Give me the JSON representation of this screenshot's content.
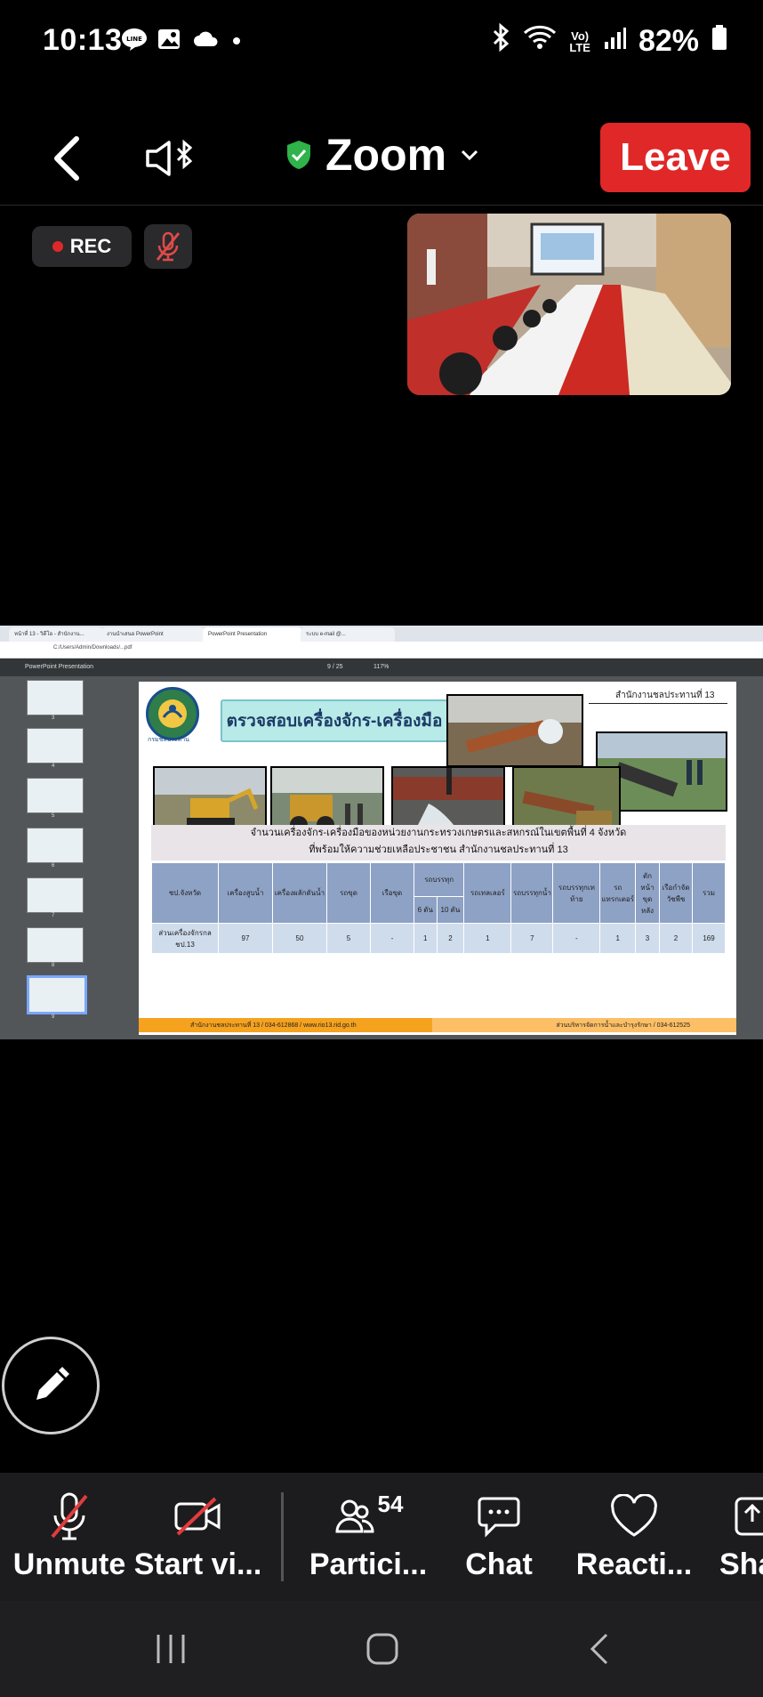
{
  "status_bar": {
    "time": "10:13",
    "battery": "82%",
    "lte_label": "LTE",
    "volte_label": "Vo)"
  },
  "header": {
    "title": "Zoom",
    "leave_label": "Leave"
  },
  "badges": {
    "rec_label": "REC"
  },
  "shared_screen": {
    "browser_tabs": [
      "หน้าที่ 13 - วิดีโอ - สำนักงาน...",
      "งานนำเสนอ PowerPoint",
      "PowerPoint Presentation",
      "ระบบ e-mail @..."
    ],
    "address": "C:/Users/Admin/Downloads/...pdf",
    "pdf_title": "PowerPoint Presentation",
    "page_indicator": "9 / 25",
    "zoom_value": "117%",
    "thumbnail_numbers": [
      "3",
      "4",
      "5",
      "6",
      "7",
      "8",
      "9"
    ],
    "slide": {
      "org_name": "สำนักงานชลประทานที่ 13",
      "logo_text": "กรมชลประทาน",
      "title": "ตรวจสอบเครื่องจักร-เครื่องมือ",
      "table_title_line1": "จำนวนเครื่องจักร-เครื่องมือของหน่วยงานกระทรวงเกษตรและสหกรณ์ในเขตพื้นที่  4 จังหวัด",
      "table_title_line2": "ที่พร้อมให้ความช่วยเหลือประชาชน สำนักงานชลประทานที่ 13",
      "headers": [
        "ชป.จังหวัด",
        "เครื่องสูบน้ำ",
        "เครื่องผลักดันน้ำ",
        "รถขุด",
        "เรือขุด",
        "รถบรรทุก",
        "รถเทลเลอร์",
        "รถบรรทุกน้ำ",
        "รถบรรทุกเทท้าย",
        "รถแทรกเตอร์",
        "ตักหน้าขุดหลัง",
        "เรือกำจัดวัชพืช",
        "รวม"
      ],
      "truck_sub": [
        "6 ตัน",
        "10 ตัน"
      ],
      "row_label": "ส่วนเครื่องจักรกล ชป.13",
      "row_values": [
        "97",
        "50",
        "5",
        "-",
        "1",
        "2",
        "1",
        "7",
        "-",
        "1",
        "3",
        "2",
        "169"
      ],
      "footer_left": "สำนักงานชลประทานที่ 13  / 034-612868 / www.rio13.rid.go.th",
      "footer_right": "ส่วนบริหารจัดการน้ำและบำรุงรักษา / 034-612525"
    }
  },
  "toolbar": {
    "unmute": "Unmute",
    "start_video": "Start vi...",
    "participants": "Partici...",
    "participants_count": "54",
    "chat": "Chat",
    "reactions": "Reacti...",
    "share": "Sha"
  }
}
